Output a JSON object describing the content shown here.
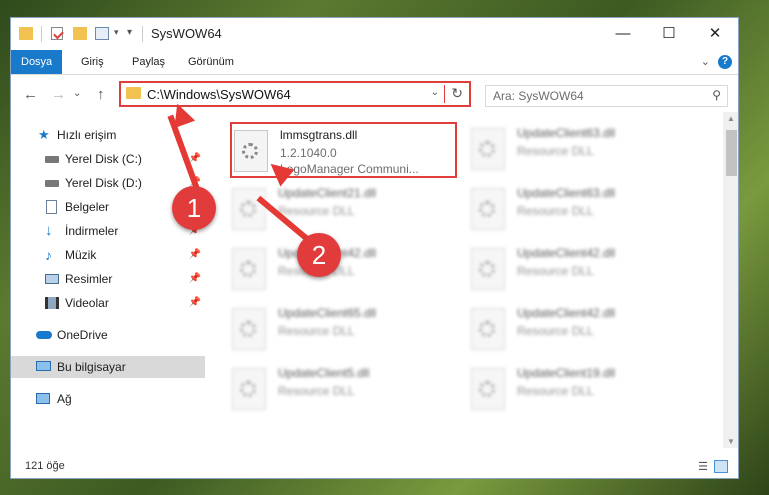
{
  "window": {
    "title": "SysWOW64",
    "minimize": "—",
    "maximize": "☐",
    "close": "✕"
  },
  "ribbon": {
    "tabs": [
      "Dosya",
      "Giriş",
      "Paylaş",
      "Görünüm"
    ],
    "expand": "⌄",
    "help": "?"
  },
  "nav": {
    "back": "←",
    "forward": "→",
    "recent": "⌄",
    "up": "↑"
  },
  "address": {
    "path": "C:\\Windows\\SysWOW64",
    "dropdown": "⌄",
    "refresh": "↻"
  },
  "search": {
    "placeholder": "Ara: SysWOW64",
    "icon": "⚲"
  },
  "sidebar": {
    "items": [
      {
        "label": "Hızlı erişim",
        "icon": "star-icon",
        "pin": ""
      },
      {
        "label": "Yerel Disk (C:)",
        "icon": "drive-icon",
        "pin": "📌"
      },
      {
        "label": "Yerel Disk (D:)",
        "icon": "drive-icon",
        "pin": "📌"
      },
      {
        "label": "Belgeler",
        "icon": "document-icon",
        "pin": "📌"
      },
      {
        "label": "İndirmeler",
        "icon": "download-icon",
        "pin": "📌"
      },
      {
        "label": "Müzik",
        "icon": "music-icon",
        "pin": "📌"
      },
      {
        "label": "Resimler",
        "icon": "pictures-icon",
        "pin": "📌"
      },
      {
        "label": "Videolar",
        "icon": "video-icon",
        "pin": "📌"
      },
      {
        "label": "OneDrive",
        "icon": "cloud-icon",
        "pin": ""
      },
      {
        "label": "Bu bilgisayar",
        "icon": "computer-icon",
        "pin": ""
      },
      {
        "label": "Ağ",
        "icon": "network-icon",
        "pin": ""
      }
    ]
  },
  "files": [
    {
      "name": "lmmsgtrans.dll",
      "line1": "1.2.1040.0",
      "line2": "LogoManager Communi..."
    },
    {
      "name": "UpdateClient63.dll",
      "line1": "Resource DLL",
      "line2": ""
    },
    {
      "name": "UpdateClient21.dll",
      "line1": "Resource DLL",
      "line2": ""
    },
    {
      "name": "UpdateClient63.dll",
      "line1": "Resource DLL",
      "line2": ""
    },
    {
      "name": "UpdateClient42.dll",
      "line1": "Resource DLL",
      "line2": ""
    },
    {
      "name": "UpdateClient42.dll",
      "line1": "Resource DLL",
      "line2": ""
    },
    {
      "name": "UpdateClient65.dll",
      "line1": "Resource DLL",
      "line2": ""
    },
    {
      "name": "UpdateClient42.dll",
      "line1": "Resource DLL",
      "line2": ""
    },
    {
      "name": "UpdateClient5.dll",
      "line1": "Resource DLL",
      "line2": ""
    },
    {
      "name": "UpdateClient19.dll",
      "line1": "Resource DLL",
      "line2": ""
    }
  ],
  "status": {
    "count": "121 öğe"
  },
  "annotations": {
    "badge1": "1",
    "badge2": "2",
    "color": "#e23b3b"
  }
}
